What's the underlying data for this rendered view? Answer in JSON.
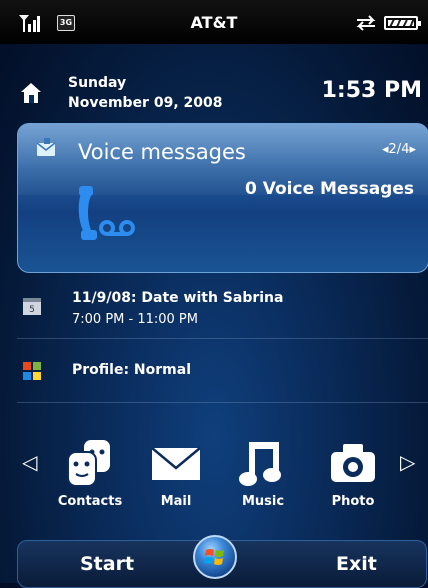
{
  "status_bar": {
    "carrier": "AT&T",
    "network_badge": "3G",
    "icons": [
      "signal-strength-icon",
      "sync-arrows-icon",
      "battery-icon"
    ]
  },
  "home": {
    "day": "Sunday",
    "date": "November 09, 2008",
    "time": "1:53 PM"
  },
  "voice_card": {
    "title": "Voice messages",
    "pager": "◂2/4▸",
    "count_label": "0 Voice Messages",
    "icons": [
      "envelope-icon",
      "voicemail-phone-icon"
    ]
  },
  "calendar": {
    "title": "11/9/08: Date with Sabrina",
    "time": "7:00 PM - 11:00 PM",
    "icon": "calendar-icon"
  },
  "profile": {
    "label": "Profile: Normal",
    "icon": "windows-flag-icon"
  },
  "quick_launch": {
    "left_arrow": "◁",
    "right_arrow": "▷",
    "items": [
      {
        "label": "Contacts",
        "icon": "contacts-icon"
      },
      {
        "label": "Mail",
        "icon": "mail-icon"
      },
      {
        "label": "Music",
        "icon": "music-note-icon"
      },
      {
        "label": "Photo",
        "icon": "camera-icon"
      }
    ]
  },
  "softkeys": {
    "left": "Start",
    "right": "Exit",
    "center_icon": "windows-start-orb-icon"
  }
}
